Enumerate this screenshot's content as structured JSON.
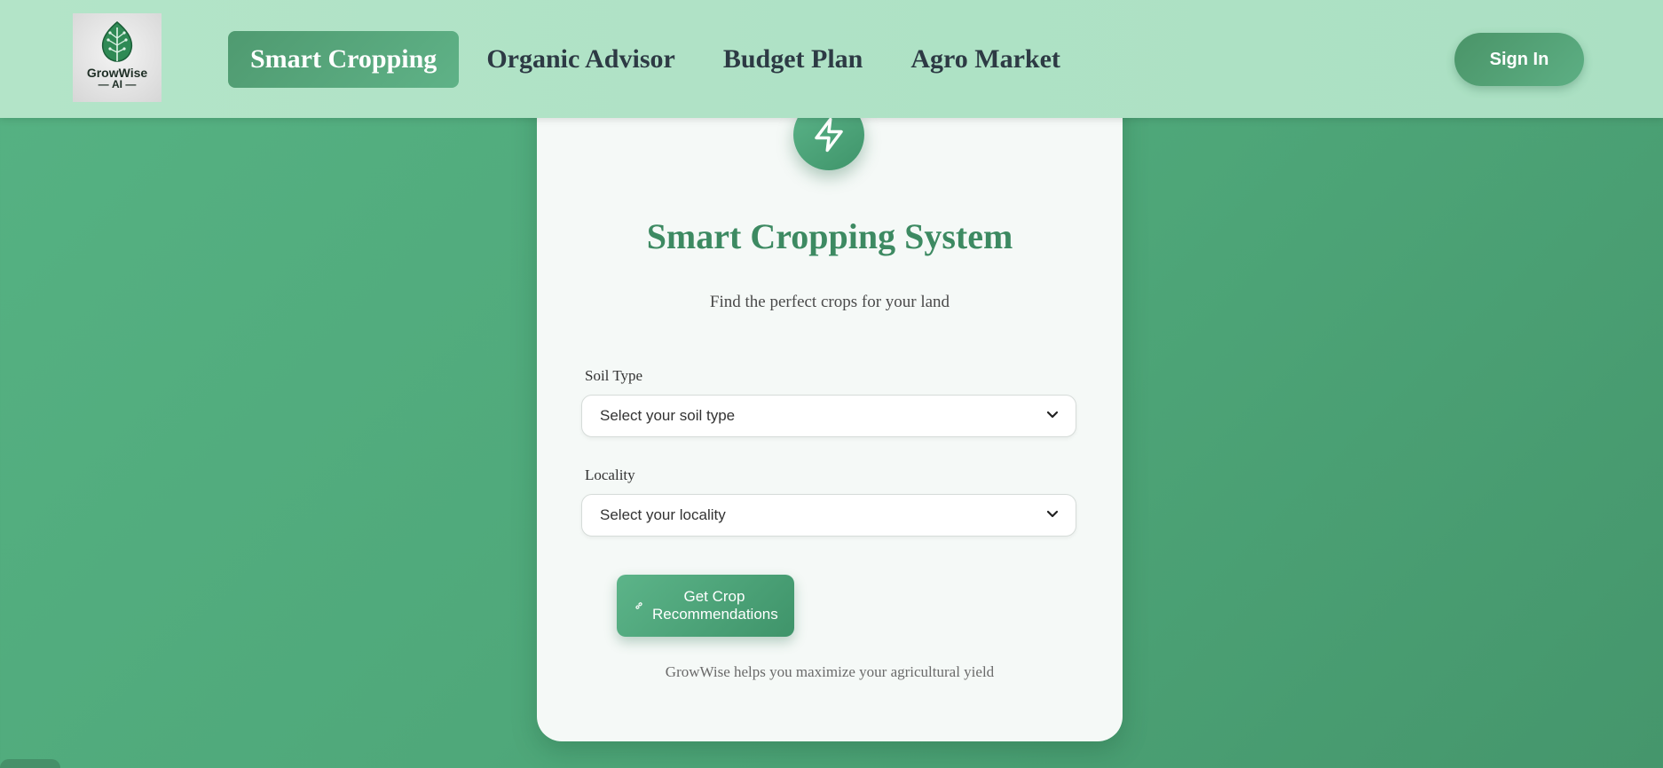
{
  "header": {
    "logo_text": "GrowWise",
    "logo_sub": "AI",
    "nav": [
      {
        "label": "Smart Cropping",
        "active": true
      },
      {
        "label": "Organic Advisor",
        "active": false
      },
      {
        "label": "Budget Plan",
        "active": false
      },
      {
        "label": "Agro Market",
        "active": false
      }
    ],
    "signin_label": "Sign In"
  },
  "card": {
    "icon": "lightning-bolt-icon",
    "title": "Smart Cropping System",
    "subtitle": "Find the perfect crops for your land",
    "soil": {
      "label": "Soil Type",
      "value": "Select your soil type"
    },
    "locality": {
      "label": "Locality",
      "value": "Select your locality"
    },
    "button_label": "Get Crop Recommendations",
    "footer_note": "GrowWise helps you maximize your agricultural yield"
  },
  "colors": {
    "background": "#52ad7f",
    "accent": "#3d8a62",
    "header": "#b3e4c8",
    "nav_text": "#2d3a44"
  }
}
